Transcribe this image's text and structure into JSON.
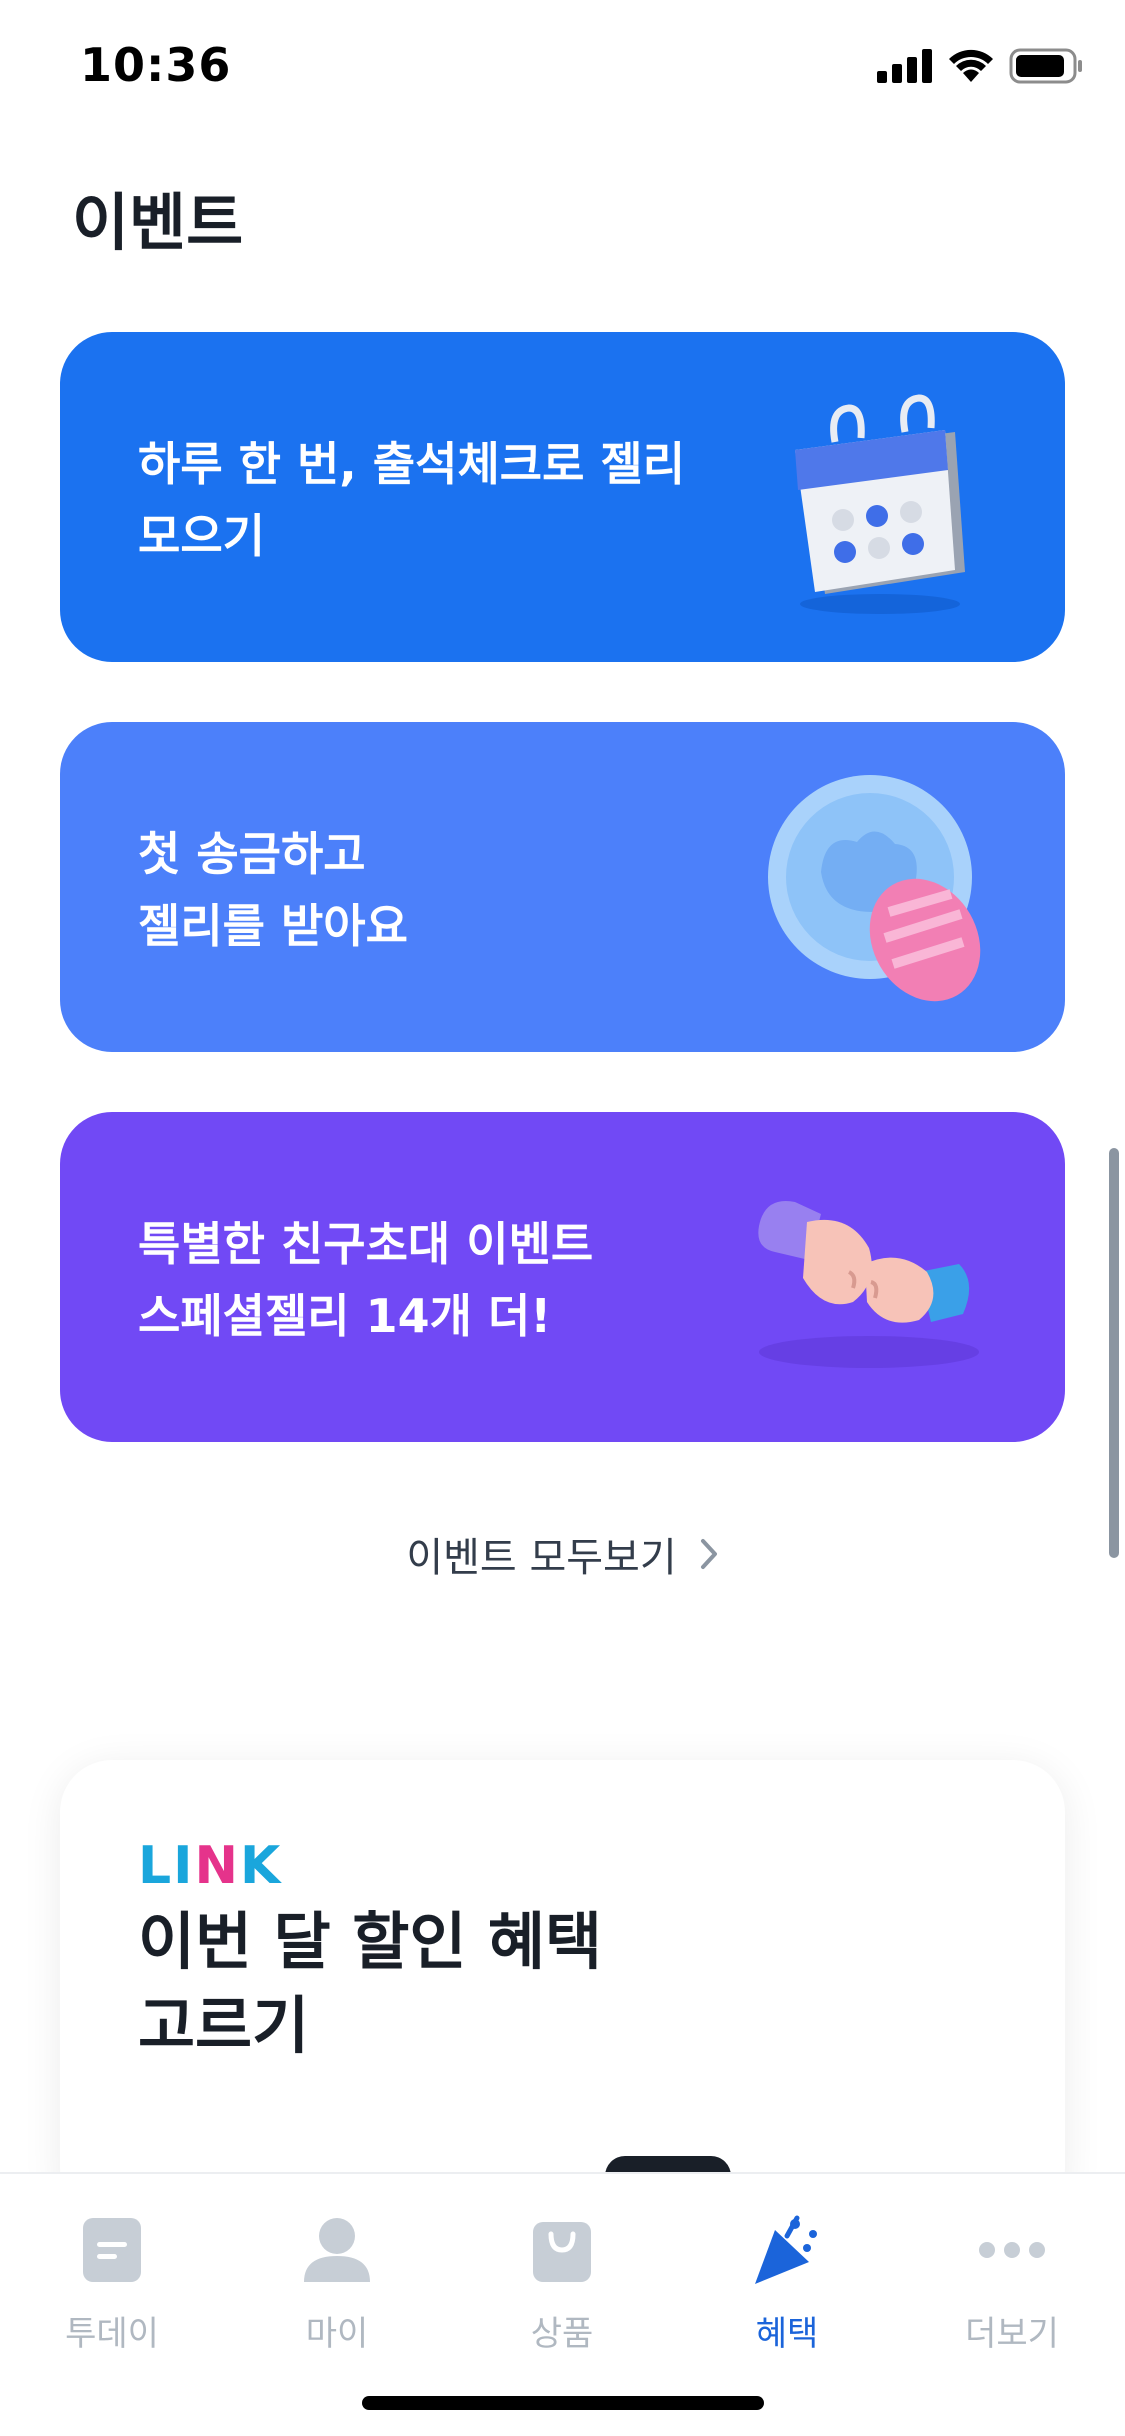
{
  "status": {
    "time": "10:36"
  },
  "page": {
    "title": "이벤트"
  },
  "events": [
    {
      "line1": "하루 한 번, 출석체크로 젤리",
      "line2": "모으기",
      "icon": "calendar-icon",
      "color": "#1b72f0"
    },
    {
      "line1": "첫 송금하고",
      "line2": "젤리를 받아요",
      "icon": "jelly-coin-icon",
      "color": "#4c80fa"
    },
    {
      "line1": "특별한 친구초대 이벤트",
      "line2": "스페셜젤리 14개 더!",
      "icon": "fist-bump-icon",
      "color": "#7149f5"
    }
  ],
  "see_all": {
    "label": "이벤트 모두보기"
  },
  "link_card": {
    "logo": "LINK",
    "title_line1": "이번 달 할인 혜택",
    "title_line2": "고르기"
  },
  "tabs": [
    {
      "label": "투데이",
      "icon": "today-icon",
      "active": false
    },
    {
      "label": "마이",
      "icon": "person-icon",
      "active": false
    },
    {
      "label": "상품",
      "icon": "shopping-bag-icon",
      "active": false
    },
    {
      "label": "혜택",
      "icon": "party-popper-icon",
      "active": true
    },
    {
      "label": "더보기",
      "icon": "more-dots-icon",
      "active": false
    }
  ],
  "colors": {
    "accent": "#1b64da",
    "inactive": "#b0b8c1"
  }
}
